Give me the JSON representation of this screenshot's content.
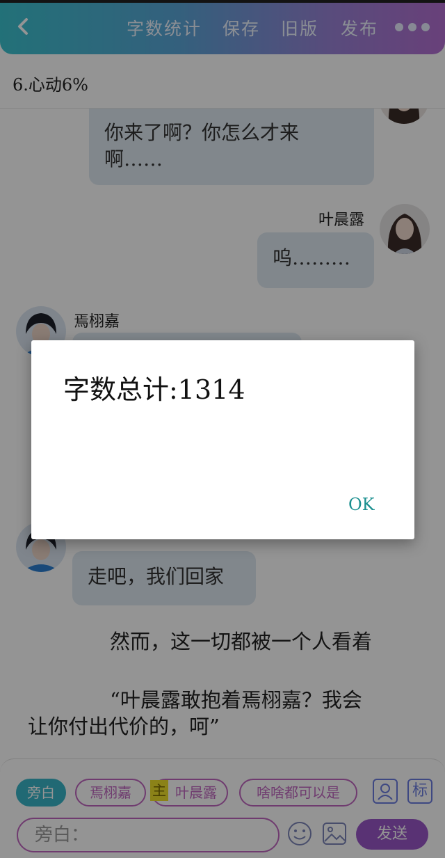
{
  "topbar": {
    "actions": [
      "字数统计",
      "保存",
      "旧版",
      "发布"
    ]
  },
  "chapter": {
    "title": "6.心动6%"
  },
  "messages": {
    "m1": {
      "text1": "你来了啊？你怎么才来",
      "text2": "啊……"
    },
    "m2": {
      "name": "叶晨露",
      "text": "呜………"
    },
    "m3": {
      "name": "焉栩嘉"
    },
    "m4": {
      "text": "走吧，我们回家"
    },
    "narration1": "然而，这一切都被一个人看着",
    "narration2_line1": "“叶晨露敢抱着焉栩嘉？我会",
    "narration2_line2": "让你付出代价的，呵”"
  },
  "bottom": {
    "chips": [
      "旁白",
      "焉栩嘉",
      "叶晨露",
      "啥啥都可以是"
    ],
    "main_tag": "主",
    "mark_icon": "标",
    "input_text": "旁白：",
    "send_label": "发送"
  },
  "dialog": {
    "message": "字数总计:1314",
    "ok_label": "OK"
  },
  "colors": {
    "topbar_start": "#3cc3cf",
    "topbar_end": "#b46fd2",
    "accent_purple": "#9a57c8",
    "chip_border": "#c067c0",
    "active_chip": "#39b6c9",
    "bubble": "#dfe8f1",
    "ok_text": "#1a8f8f"
  }
}
